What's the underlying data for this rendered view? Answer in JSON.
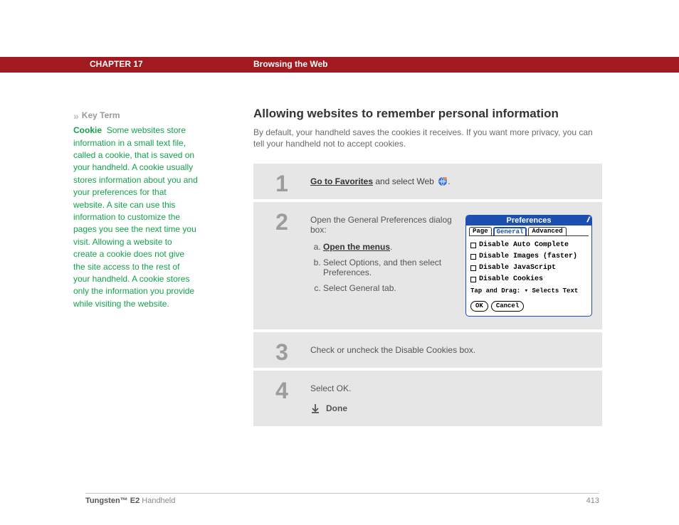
{
  "header": {
    "chapter": "CHAPTER 17",
    "section": "Browsing the Web"
  },
  "sidebar": {
    "arrows": "»",
    "label": "Key Term",
    "term": "Cookie",
    "text": "Some websites store information in a small text file, called a cookie, that is saved on your handheld. A cookie usually stores information about you and your preferences for that website. A site can use this information to customize the pages you see the next time you visit. Allowing a website to create a cookie does not give the site access to the rest of your handheld. A cookie stores only the information you provide while visiting the website."
  },
  "main": {
    "title": "Allowing websites to remember personal information",
    "intro": "By default, your handheld saves the cookies it receives. If you want more privacy, you can tell your handheld not to accept cookies."
  },
  "steps": {
    "s1": {
      "num": "1",
      "link": "Go to Favorites",
      "rest": " and select Web ",
      "period": "."
    },
    "s2": {
      "num": "2",
      "lead": "Open the General Preferences dialog box:",
      "a_link": "Open the menus",
      "a_after": ".",
      "b": "Select Options, and then select Preferences.",
      "c": "Select General tab."
    },
    "s3": {
      "num": "3",
      "text": "Check or uncheck the Disable Cookies box."
    },
    "s4": {
      "num": "4",
      "text": "Select OK.",
      "done": "Done"
    }
  },
  "prefs": {
    "title": "Preferences",
    "tabs": {
      "page": "Page",
      "general": "General",
      "advanced": "Advanced"
    },
    "rows": {
      "auto": "Disable Auto Complete",
      "images": "Disable Images (faster)",
      "js": "Disable JavaScript",
      "cookies": "Disable Cookies"
    },
    "tap_label": "Tap and Drag:",
    "tap_value": "Selects Text",
    "ok": "OK",
    "cancel": "Cancel"
  },
  "footer": {
    "product_bold": "Tungsten™ E2",
    "product_rest": " Handheld",
    "page": "413"
  }
}
